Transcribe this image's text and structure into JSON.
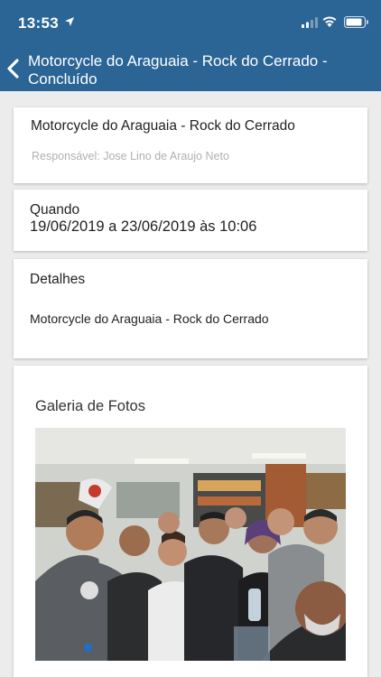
{
  "status_bar": {
    "time": "13:53",
    "icons": [
      "location-arrow-icon",
      "cellular-signal-icon",
      "wifi-icon",
      "battery-icon"
    ]
  },
  "navbar": {
    "back_icon": "chevron-left-icon",
    "title": "Motorcycle do Araguaia - Rock do Cerrado - Concluído"
  },
  "event": {
    "name": "Motorcycle do Araguaia - Rock do Cerrado",
    "responsavel": "Responsável: Jose Lino de Araujo Neto"
  },
  "when": {
    "label": "Quando",
    "value": "19/06/2019 a 23/06/2019 às 10:06"
  },
  "details": {
    "label": "Detalhes",
    "value": "Motorcycle do Araguaia - Rock do Cerrado"
  },
  "gallery": {
    "title": "Galeria de Fotos",
    "photo_subject": "group-selfie-photo"
  },
  "colors": {
    "header": "#2b6596",
    "background": "#ececec",
    "card": "#ffffff",
    "page_indicator": "#1e6fd1"
  }
}
